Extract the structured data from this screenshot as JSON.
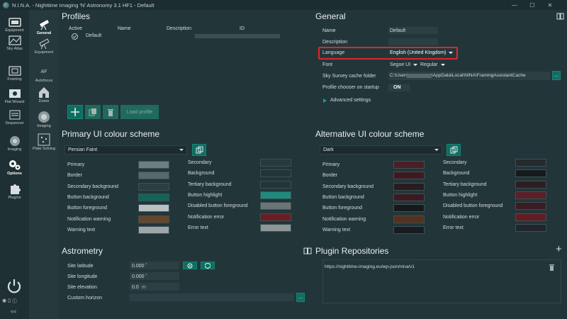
{
  "window": {
    "title": "N.I.N.A. - Nighttime Imaging 'N' Astronomy 3.1 HF1  -  Default",
    "minimize": "—",
    "maximize": "☐",
    "close": "✕"
  },
  "sidebar": {
    "items": [
      {
        "label": "Equipment",
        "icon": "camera-icon"
      },
      {
        "label": "Sky Atlas",
        "icon": "sky-atlas-icon"
      },
      {
        "label": "Framing",
        "icon": "framing-icon"
      },
      {
        "label": "Flat Wizard",
        "icon": "flat-wizard-icon"
      },
      {
        "label": "Sequencer",
        "icon": "sequencer-icon"
      },
      {
        "label": "Imaging",
        "icon": "imaging-icon"
      },
      {
        "label": "Options",
        "icon": "gears-icon"
      },
      {
        "label": "Plugins",
        "icon": "puzzle-icon"
      }
    ],
    "collapse": "<<"
  },
  "subnav": {
    "items": [
      {
        "label": "General"
      },
      {
        "label": "Equipment"
      },
      {
        "label": "Autofocus",
        "badge": "AF"
      },
      {
        "label": "Dome"
      },
      {
        "label": "Imaging"
      },
      {
        "label": "Plate Solving"
      }
    ]
  },
  "profiles": {
    "heading": "Profiles",
    "columns": [
      "Active",
      "Name",
      "Description",
      "ID"
    ],
    "row": {
      "name": "Default",
      "id": ""
    },
    "load_profile": "Load profile"
  },
  "general": {
    "heading": "General",
    "name_label": "Name",
    "name_value": "Default",
    "description_label": "Description",
    "description_value": "",
    "language_label": "Language",
    "language_value": "English (United Kingdom)",
    "font_label": "Font",
    "font_value": "Segoe UI",
    "font_weight": "Regular",
    "cache_label": "Sky Survey cache folder",
    "cache_prefix": "C:\\Users\\",
    "cache_suffix": "\\AppData\\Local\\NINA\\FramingAssistantCache",
    "chooser_label": "Profile chooser on startup",
    "chooser_value": "ON",
    "advanced": "Advanced settings",
    "highlight_color": "#e0262b"
  },
  "primary_scheme": {
    "heading": "Primary UI colour scheme",
    "selected": "Persian Faint",
    "left": [
      {
        "label": "Primary",
        "color": "#6e7f82"
      },
      {
        "label": "Border",
        "color": "#56696c"
      },
      {
        "label": "Secondary background",
        "color": "#2b3e42"
      },
      {
        "label": "Button background",
        "color": "#126456"
      },
      {
        "label": "Button foreground",
        "color": "#b9c0c1"
      },
      {
        "label": "Notification warning",
        "color": "#66452a"
      },
      {
        "label": "Warning text",
        "color": "#9ea6a8"
      }
    ],
    "right": [
      {
        "label": "Secondary",
        "color": "#263a3e"
      },
      {
        "label": "Background",
        "color": "#22363a"
      },
      {
        "label": "Tertiary background",
        "color": "#22363a"
      },
      {
        "label": "Button highlight",
        "color": "#1e8a7c"
      },
      {
        "label": "Disabled button foreground",
        "color": "#6b7476"
      },
      {
        "label": "Notification error",
        "color": "#6a1e24"
      },
      {
        "label": "Error text",
        "color": "#8d9597"
      }
    ]
  },
  "alt_scheme": {
    "heading": "Alternative UI colour scheme",
    "selected": "Dark",
    "left": [
      {
        "label": "Primary",
        "color": "#4b1e26"
      },
      {
        "label": "Border",
        "color": "#3d1a20"
      },
      {
        "label": "Secondary background",
        "color": "#2a1b1f"
      },
      {
        "label": "Button background",
        "color": "#3b1a20"
      },
      {
        "label": "Button foreground",
        "color": "#16191b"
      },
      {
        "label": "Notification warning",
        "color": "#55311e"
      },
      {
        "label": "Warning text",
        "color": "#181c1e"
      }
    ],
    "right": [
      {
        "label": "Secondary",
        "color": "#252a2c"
      },
      {
        "label": "Background",
        "color": "#151a1c"
      },
      {
        "label": "Tertiary background",
        "color": "#2d1d21"
      },
      {
        "label": "Button highlight",
        "color": "#5a1f27"
      },
      {
        "label": "Disabled button foreground",
        "color": "#3a1c22"
      },
      {
        "label": "Notification error",
        "color": "#631c24"
      },
      {
        "label": "Error text",
        "color": "#20262a"
      }
    ]
  },
  "astrometry": {
    "heading": "Astrometry",
    "lat_label": "Site latitude",
    "lat_value": "0.000",
    "lat_unit": "°",
    "lon_label": "Site longitude",
    "lon_value": "0.000",
    "lon_unit": "°",
    "elev_label": "Site elevation",
    "elev_value": "0.0",
    "elev_unit": "m",
    "horizon_label": "Custom horizon",
    "browse": "..."
  },
  "plugins": {
    "heading": "Plugin Repositories",
    "url": "https://nighttime-imaging.eu/wp-json/nina/v1",
    "add": "+"
  }
}
